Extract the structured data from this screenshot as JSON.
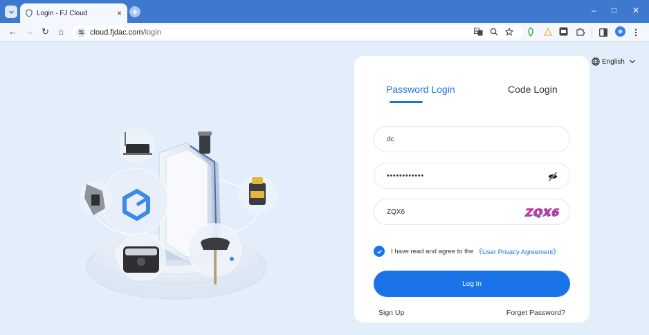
{
  "browser": {
    "tab_title": "Login - FJ Cloud",
    "tab_close": "×",
    "new_tab": "+",
    "url_host": "cloud.fjdac.com",
    "url_path": "/login",
    "window_controls": {
      "minimize": "–",
      "maximize": "□",
      "close": "✕"
    },
    "nav": {
      "back": "←",
      "forward": "→",
      "reload": "↻",
      "home": "⌂"
    },
    "toolbar_icons": [
      "translate-icon",
      "zoom-icon",
      "bookmark-star-icon",
      "extension-leaf-icon",
      "extension-warning-icon",
      "extension-ai-icon",
      "extensions-puzzle-icon",
      "side-panel-icon",
      "profile-avatar-icon",
      "more-menu-icon"
    ]
  },
  "login": {
    "language": "English",
    "tabs": {
      "password": "Password Login",
      "code": "Code Login"
    },
    "username_value": "dc",
    "password_value": "••••••••••••",
    "captcha_value": "ZQX6",
    "captcha_text": "ZQX6",
    "agreement_text": "I have read and agree to the",
    "agreement_link": "《User Privacy Agreement》",
    "login_button": "Log In",
    "sign_up": "Sign Up",
    "forget_password": "Forget Password?"
  },
  "colors": {
    "accent": "#1a73e8",
    "chrome": "#3f79cf",
    "page_bg": "#e3eefb"
  }
}
